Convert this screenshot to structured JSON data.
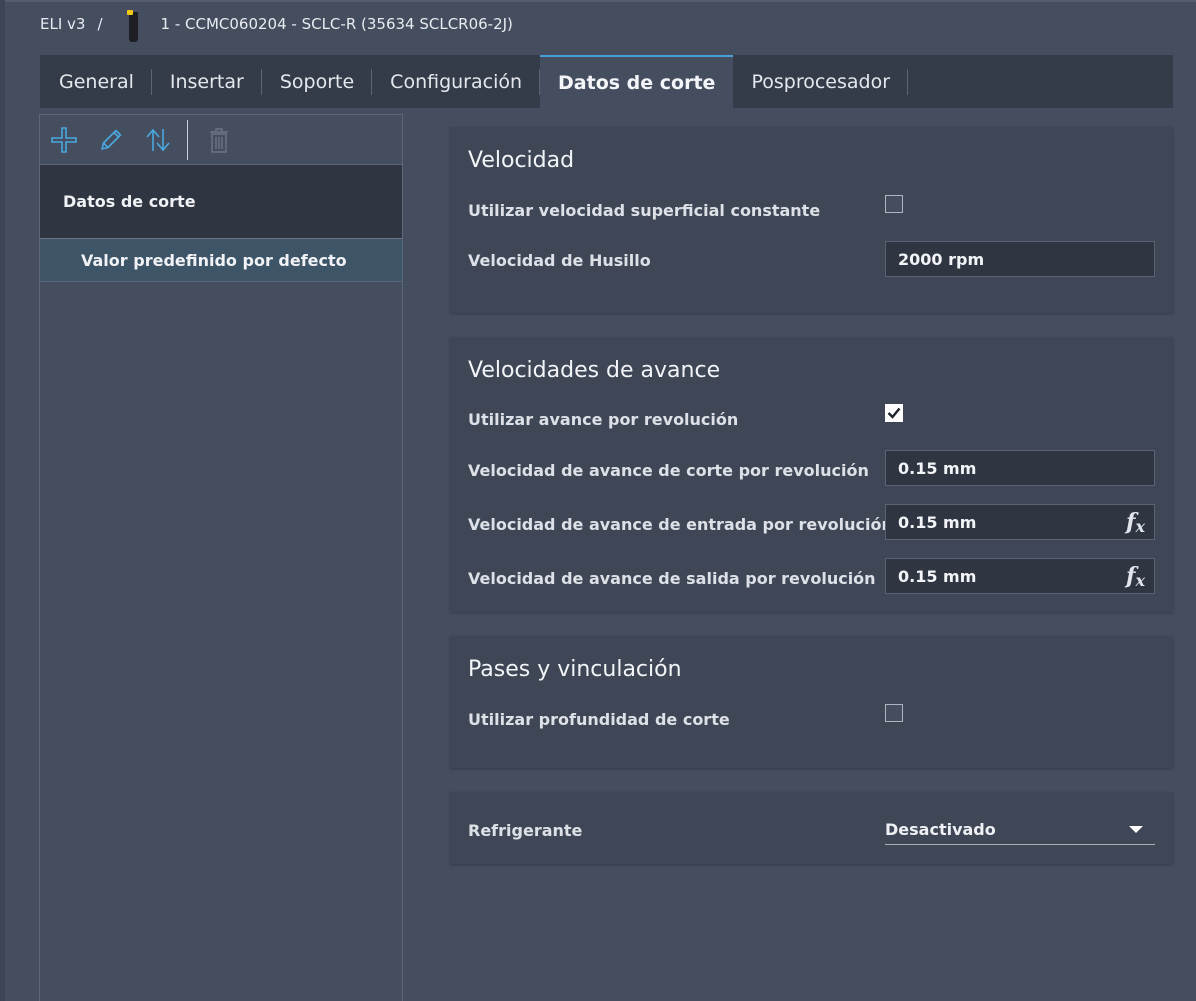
{
  "breadcrumb": {
    "root": "ELI v3",
    "separator": "/",
    "tool": "1 - CCMC060204 - SCLC-R (35634 SCLCR06-2J)"
  },
  "tabs": [
    {
      "label": "General",
      "active": false
    },
    {
      "label": "Insertar",
      "active": false
    },
    {
      "label": "Soporte",
      "active": false
    },
    {
      "label": "Configuración",
      "active": false
    },
    {
      "label": "Datos de corte",
      "active": true
    },
    {
      "label": "Posprocesador",
      "active": false
    }
  ],
  "left_panel": {
    "toolbar": {
      "add_icon": "plus-icon",
      "edit_icon": "pencil-icon",
      "sort_icon": "sort-arrows-icon",
      "delete_icon": "trash-icon"
    },
    "header": "Datos de corte",
    "items": [
      {
        "label": "Valor predefinido por defecto",
        "selected": true
      }
    ]
  },
  "velocidad": {
    "title": "Velocidad",
    "constant_surface_label": "Utilizar velocidad superficial constante",
    "constant_surface_checked": false,
    "spindle_label": "Velocidad de Husillo",
    "spindle_value": "2000 rpm"
  },
  "avance": {
    "title": "Velocidades de avance",
    "per_rev_label": "Utilizar avance por revolución",
    "per_rev_checked": true,
    "cutting_label": "Velocidad de avance de corte por revolución",
    "cutting_value": "0.15 mm",
    "entry_label": "Velocidad de avance de entrada por revolución",
    "entry_value": "0.15 mm",
    "exit_label": "Velocidad de avance de salida por revolución",
    "exit_value": "0.15 mm",
    "fx_icon": "function-fx-icon"
  },
  "pases": {
    "title": "Pases y vinculación",
    "depth_label": "Utilizar profundidad de corte",
    "depth_checked": false
  },
  "refrigerante": {
    "label": "Refrigerante",
    "value": "Desactivado"
  },
  "colors": {
    "background": "#454e5f",
    "card": "#3f4756",
    "tabbar": "#353c49",
    "accent": "#4aa0d6",
    "selected_item": "#3e5568"
  }
}
